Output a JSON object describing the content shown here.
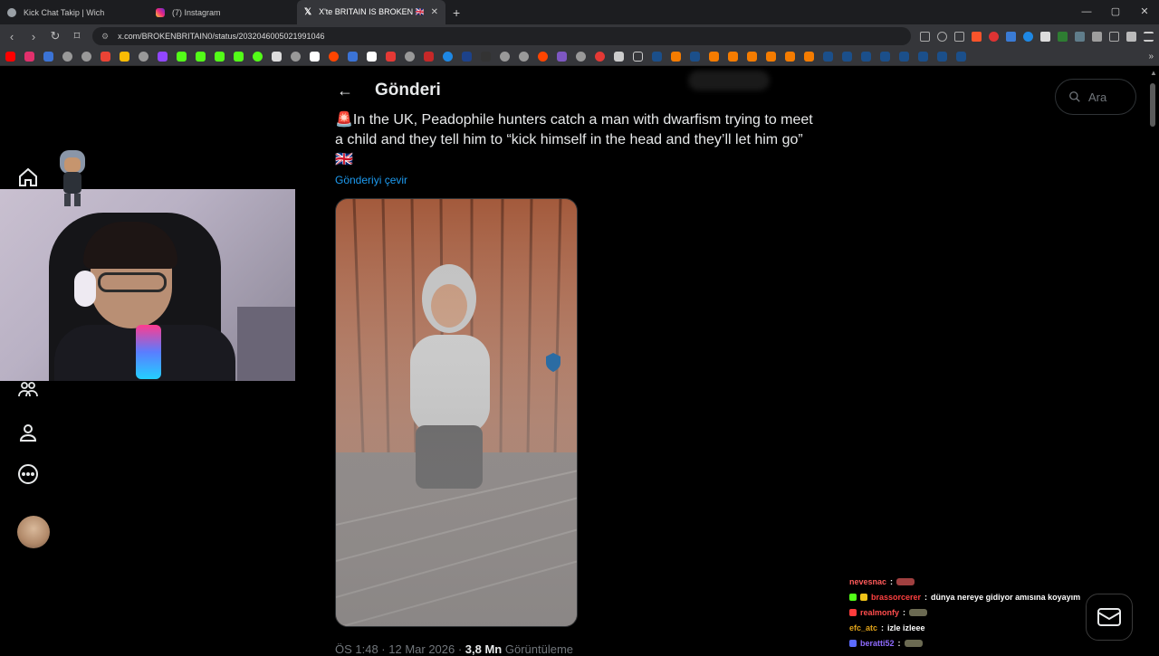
{
  "browser": {
    "tabs": [
      {
        "title": "Kick Chat Takip | Wich",
        "favicon_color": "#9aa0a6"
      },
      {
        "title": "(7) Instagram",
        "favicon_color": "#e1306c"
      },
      {
        "title": "X'te BRITAIN IS BROKEN 🇬🇧: \" ...",
        "favicon_color": "#ffffff",
        "active": true
      }
    ],
    "new_tab": "+",
    "window_controls": [
      "—",
      "▢",
      "✕"
    ],
    "url": "x.com/BROKENBRITAIN0/status/2032046005021991046"
  },
  "x": {
    "header_title": "Gönderi",
    "search_placeholder": "Ara",
    "tweet": {
      "text": "🚨In the UK, Peadophile hunters catch a man with dwarfism trying to meet a child and they tell him to “kick himself in the head and they’ll let him go” 🇬🇧",
      "translate_label": "Gönderiyi çevir",
      "time": "ÖS 1:48 · 12 Mar 2026 · ",
      "views_value": "3,8 Mn",
      "views_label": " Görüntüleme"
    }
  },
  "chat": [
    {
      "user": "nevesnac",
      "color": "#ff5a5a",
      "message": "",
      "badge": "",
      "emote": true
    },
    {
      "user": "brassorcerer",
      "color": "#ff4040",
      "message": "dünya nereye gidiyor amısına koyayım",
      "badge": "#53fc18",
      "emote": false
    },
    {
      "user": "realmonfy",
      "color": "#ff4d4d",
      "message": "",
      "badge": "#ff3d3d",
      "emote": true
    },
    {
      "user": "efc_atc",
      "color": "#e0a31a",
      "message": "izle izleee",
      "badge": "",
      "emote": false
    },
    {
      "user": "beratti52",
      "color": "#8f6bff",
      "message": "",
      "badge": "#5b6bff",
      "emote": true
    }
  ]
}
